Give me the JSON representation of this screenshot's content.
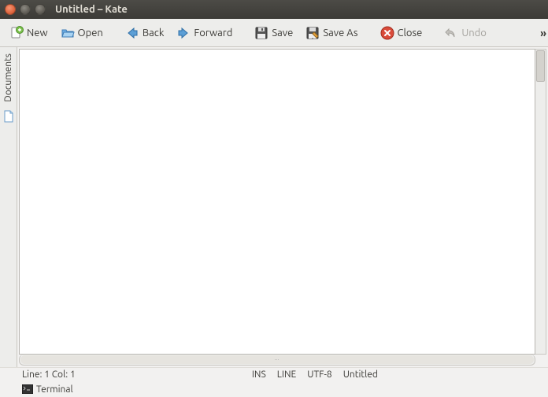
{
  "window": {
    "title": "Untitled – Kate"
  },
  "toolbar": {
    "new_label": "New",
    "open_label": "Open",
    "back_label": "Back",
    "forward_label": "Forward",
    "save_label": "Save",
    "saveas_label": "Save As",
    "close_label": "Close",
    "undo_label": "Undo",
    "overflow": "»"
  },
  "sidebar": {
    "documents_label": "Documents"
  },
  "status": {
    "position": "Line: 1 Col: 1",
    "insert_mode": "INS",
    "line_mode": "LINE",
    "encoding": "UTF-8",
    "doc_name": "Untitled"
  },
  "bottom": {
    "terminal_label": "Terminal"
  }
}
